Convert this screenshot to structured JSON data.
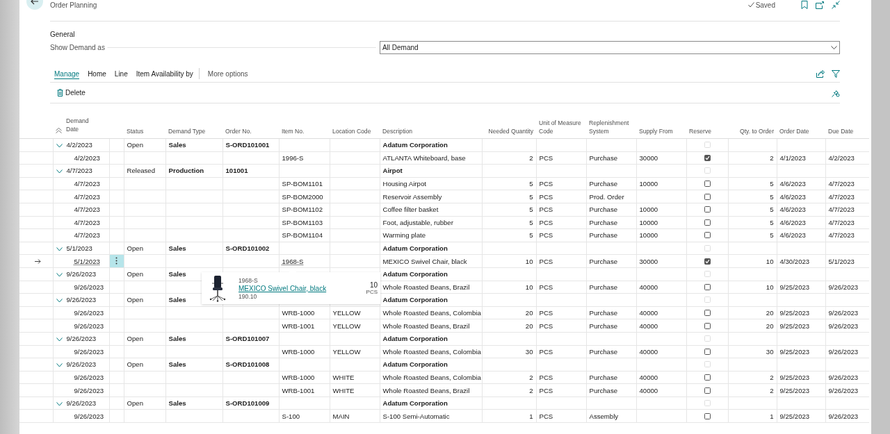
{
  "page": {
    "title": "Order Planning",
    "save_status": "Saved"
  },
  "general": {
    "heading": "General",
    "show_demand_as": {
      "label": "Show Demand as",
      "value": "All Demand"
    }
  },
  "tabs": [
    {
      "label": "Manage",
      "selected": true
    },
    {
      "label": "Home",
      "selected": false
    },
    {
      "label": "Line",
      "selected": false
    },
    {
      "label": "Item Availability by",
      "selected": false
    }
  ],
  "more_options": "More options",
  "actions": [
    {
      "label": "Delete"
    }
  ],
  "table": {
    "columns": [
      "Demand Date",
      "Status",
      "Demand Type",
      "Order No.",
      "Item No.",
      "Location Code",
      "Description",
      "Needed Quantity",
      "Unit of Measure Code",
      "Replenishment System",
      "Supply From",
      "Reserve",
      "Qty. to Order",
      "Order Date",
      "Due Date"
    ],
    "rows": [
      {
        "kind": "group",
        "selected": false,
        "expanded": true,
        "date": "4/2/2023",
        "status": "Open",
        "demand_type": "Sales",
        "order_no": "S-ORD101001",
        "description": "Adatum Corporation",
        "reserve_checked": false,
        "reserve_disabled": true
      },
      {
        "kind": "line",
        "selected": false,
        "date": "4/2/2023",
        "item_no": "1996-S",
        "description": "ATLANTA Whiteboard, base",
        "needed_quantity": "2",
        "unit_of_measure_code": "PCS",
        "replenishment_system": "Purchase",
        "supply_from": "30000",
        "reserve_checked": true,
        "reserve_disabled": false,
        "qty_to_order": "2",
        "order_date": "4/1/2023",
        "due_date": "4/2/2023"
      },
      {
        "kind": "group",
        "selected": false,
        "expanded": true,
        "date": "4/7/2023",
        "status": "Released",
        "demand_type": "Production",
        "order_no": "101001",
        "description": "Airpot",
        "reserve_checked": false,
        "reserve_disabled": true
      },
      {
        "kind": "line",
        "selected": false,
        "date": "4/7/2023",
        "item_no": "SP-BOM1101",
        "description": "Housing Airpot",
        "needed_quantity": "5",
        "unit_of_measure_code": "PCS",
        "replenishment_system": "Purchase",
        "supply_from": "10000",
        "reserve_checked": false,
        "reserve_disabled": false,
        "qty_to_order": "5",
        "order_date": "4/6/2023",
        "due_date": "4/7/2023"
      },
      {
        "kind": "line",
        "selected": false,
        "date": "4/7/2023",
        "item_no": "SP-BOM2000",
        "description": "Reservoir Assembly",
        "needed_quantity": "5",
        "unit_of_measure_code": "PCS",
        "replenishment_system": "Prod. Order",
        "reserve_checked": false,
        "reserve_disabled": false,
        "qty_to_order": "5",
        "order_date": "4/6/2023",
        "due_date": "4/7/2023"
      },
      {
        "kind": "line",
        "selected": false,
        "date": "4/7/2023",
        "item_no": "SP-BOM1102",
        "description": "Coffee filter basket",
        "needed_quantity": "5",
        "unit_of_measure_code": "PCS",
        "replenishment_system": "Purchase",
        "supply_from": "10000",
        "reserve_checked": false,
        "reserve_disabled": false,
        "qty_to_order": "5",
        "order_date": "4/6/2023",
        "due_date": "4/7/2023"
      },
      {
        "kind": "line",
        "selected": false,
        "date": "4/7/2023",
        "item_no": "SP-BOM1103",
        "description": "Foot, adjustable, rubber",
        "needed_quantity": "5",
        "unit_of_measure_code": "PCS",
        "replenishment_system": "Purchase",
        "supply_from": "10000",
        "reserve_checked": false,
        "reserve_disabled": false,
        "qty_to_order": "5",
        "order_date": "4/6/2023",
        "due_date": "4/7/2023"
      },
      {
        "kind": "line",
        "selected": false,
        "date": "4/7/2023",
        "item_no": "SP-BOM1104",
        "description": "Warming plate",
        "needed_quantity": "5",
        "unit_of_measure_code": "PCS",
        "replenishment_system": "Purchase",
        "supply_from": "10000",
        "reserve_checked": false,
        "reserve_disabled": false,
        "qty_to_order": "5",
        "order_date": "4/6/2023",
        "due_date": "4/7/2023"
      },
      {
        "kind": "group",
        "selected": false,
        "expanded": true,
        "date": "5/1/2023",
        "status": "Open",
        "demand_type": "Sales",
        "order_no": "S-ORD101002",
        "description": "Adatum Corporation",
        "reserve_checked": false,
        "reserve_disabled": true
      },
      {
        "kind": "line",
        "selected": true,
        "date": "5/1/2023",
        "item_no": "1968-S",
        "description": "MEXICO Swivel Chair, black",
        "needed_quantity": "10",
        "unit_of_measure_code": "PCS",
        "replenishment_system": "Purchase",
        "supply_from": "30000",
        "reserve_checked": true,
        "reserve_disabled": false,
        "qty_to_order": "10",
        "order_date": "4/30/2023",
        "due_date": "5/1/2023"
      },
      {
        "kind": "group",
        "selected": false,
        "expanded": true,
        "date": "9/26/2023",
        "status": "Open",
        "demand_type": "Sales",
        "description": "Adatum Corporation",
        "reserve_checked": false,
        "reserve_disabled": true
      },
      {
        "kind": "line",
        "selected": false,
        "date": "9/26/2023",
        "description": "Whole Roasted Beans, Brazil",
        "needed_quantity": "10",
        "unit_of_measure_code": "PCS",
        "replenishment_system": "Purchase",
        "supply_from": "40000",
        "reserve_checked": false,
        "reserve_disabled": false,
        "qty_to_order": "10",
        "order_date": "9/25/2023",
        "due_date": "9/26/2023"
      },
      {
        "kind": "group",
        "selected": false,
        "expanded": true,
        "date": "9/26/2023",
        "status": "Open",
        "demand_type": "Sales",
        "description": "Adatum Corporation",
        "reserve_checked": false,
        "reserve_disabled": true
      },
      {
        "kind": "line",
        "selected": false,
        "date": "9/26/2023",
        "item_no": "WRB-1000",
        "location_code": "YELLOW",
        "description": "Whole Roasted Beans, Colombia",
        "needed_quantity": "20",
        "unit_of_measure_code": "PCS",
        "replenishment_system": "Purchase",
        "supply_from": "40000",
        "reserve_checked": false,
        "reserve_disabled": false,
        "qty_to_order": "20",
        "order_date": "9/25/2023",
        "due_date": "9/26/2023"
      },
      {
        "kind": "line",
        "selected": false,
        "date": "9/26/2023",
        "item_no": "WRB-1001",
        "location_code": "YELLOW",
        "description": "Whole Roasted Beans, Brazil",
        "needed_quantity": "20",
        "unit_of_measure_code": "PCS",
        "replenishment_system": "Purchase",
        "supply_from": "40000",
        "reserve_checked": false,
        "reserve_disabled": false,
        "qty_to_order": "20",
        "order_date": "9/25/2023",
        "due_date": "9/26/2023"
      },
      {
        "kind": "group",
        "selected": false,
        "expanded": true,
        "date": "9/26/2023",
        "status": "Open",
        "demand_type": "Sales",
        "order_no": "S-ORD101007",
        "description": "Adatum Corporation",
        "reserve_checked": false,
        "reserve_disabled": true
      },
      {
        "kind": "line",
        "selected": false,
        "date": "9/26/2023",
        "item_no": "WRB-1000",
        "location_code": "YELLOW",
        "description": "Whole Roasted Beans, Colombia",
        "needed_quantity": "30",
        "unit_of_measure_code": "PCS",
        "replenishment_system": "Purchase",
        "supply_from": "40000",
        "reserve_checked": false,
        "reserve_disabled": false,
        "qty_to_order": "30",
        "order_date": "9/25/2023",
        "due_date": "9/26/2023"
      },
      {
        "kind": "group",
        "selected": false,
        "expanded": true,
        "date": "9/26/2023",
        "status": "Open",
        "demand_type": "Sales",
        "order_no": "S-ORD101008",
        "description": "Adatum Corporation",
        "reserve_checked": false,
        "reserve_disabled": true
      },
      {
        "kind": "line",
        "selected": false,
        "date": "9/26/2023",
        "item_no": "WRB-1000",
        "location_code": "WHITE",
        "description": "Whole Roasted Beans, Colombia",
        "needed_quantity": "2",
        "unit_of_measure_code": "PCS",
        "replenishment_system": "Purchase",
        "supply_from": "40000",
        "reserve_checked": false,
        "reserve_disabled": false,
        "qty_to_order": "2",
        "order_date": "9/25/2023",
        "due_date": "9/26/2023"
      },
      {
        "kind": "line",
        "selected": false,
        "date": "9/26/2023",
        "item_no": "WRB-1001",
        "location_code": "WHITE",
        "description": "Whole Roasted Beans, Brazil",
        "needed_quantity": "2",
        "unit_of_measure_code": "PCS",
        "replenishment_system": "Purchase",
        "supply_from": "40000",
        "reserve_checked": false,
        "reserve_disabled": false,
        "qty_to_order": "2",
        "order_date": "9/25/2023",
        "due_date": "9/26/2023"
      },
      {
        "kind": "group",
        "selected": false,
        "expanded": true,
        "date": "9/26/2023",
        "status": "Open",
        "demand_type": "Sales",
        "order_no": "S-ORD101009",
        "description": "Adatum Corporation",
        "reserve_checked": false,
        "reserve_disabled": true
      },
      {
        "kind": "line",
        "selected": false,
        "date": "9/26/2023",
        "item_no": "S-100",
        "location_code": "MAIN",
        "description": "S-100 Semi-Automatic",
        "needed_quantity": "1",
        "unit_of_measure_code": "PCS",
        "replenishment_system": "Assembly",
        "reserve_checked": false,
        "reserve_disabled": false,
        "qty_to_order": "1",
        "order_date": "9/25/2023",
        "due_date": "9/26/2023"
      }
    ]
  },
  "item_card": {
    "item_no": "1968-S",
    "description": "MEXICO Swivel Chair, black",
    "unit_price": "190.10",
    "quantity": "10",
    "unit": "PCS"
  }
}
